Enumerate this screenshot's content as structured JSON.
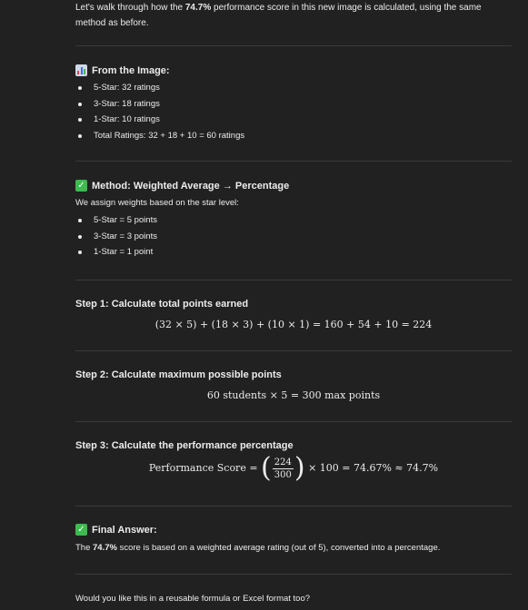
{
  "intro": {
    "text_before": "Let's walk through how the ",
    "highlight": "74.7%",
    "text_after": " performance score in this new image is calculated, using the same method as before."
  },
  "from_image": {
    "icon": "bar-chart-emoji",
    "title": "From the Image:",
    "items": [
      {
        "label": "5-Star:",
        "value": " 32 ratings"
      },
      {
        "label": "3-Star:",
        "value": " 18 ratings"
      },
      {
        "label": "1-Star:",
        "value": " 10 ratings"
      },
      {
        "label": "Total Ratings:",
        "value": " 32 + 18 + 10 = 60 ratings"
      }
    ]
  },
  "method": {
    "icon": "check-mark-emoji",
    "title": "Method: Weighted Average → Percentage",
    "intro": "We assign weights based on the star level:",
    "items": [
      "5-Star = 5 points",
      "3-Star = 3 points",
      "1-Star = 1 point"
    ]
  },
  "step1": {
    "title": "Step 1: Calculate total points earned",
    "formula": "(32 × 5) + (18 × 3) + (10 × 1) = 160 + 54 + 10 = 224"
  },
  "step2": {
    "title": "Step 2: Calculate maximum possible points",
    "formula": "60 students × 5 = 300 max points"
  },
  "step3": {
    "title": "Step 3: Calculate the performance percentage",
    "formula_prefix": "Performance Score =",
    "numerator": "224",
    "denominator": "300",
    "formula_suffix": "× 100 = 74.67% ≈ 74.7%"
  },
  "final": {
    "icon": "check-mark-emoji",
    "title": "Final Answer:",
    "text_before": "The ",
    "highlight": "74.7%",
    "text_after": " score is based on a weighted average rating (out of 5), converted into a percentage."
  },
  "closing": "Would you like this in a reusable formula or Excel format too?",
  "colors": {
    "background": "#212121",
    "text": "#ececec",
    "divider": "#3a3a3a",
    "check": "#3fb950"
  }
}
